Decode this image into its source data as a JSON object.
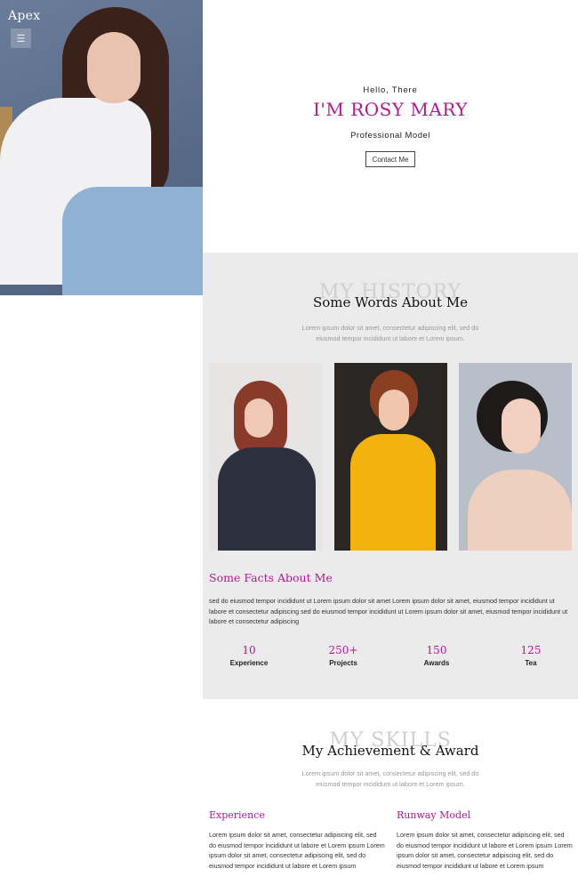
{
  "brand": "Apex",
  "menu_icon": "☰",
  "hero": {
    "greeting": "Hello, There",
    "name": "I'M ROSY MARY",
    "role": "Professional Model",
    "contact_label": "Contact Me"
  },
  "history": {
    "ghost_title": "MY HISTORY",
    "title": "Some Words About Me",
    "subtitle_line1": "Lorem ipsum dolor sit amet, consectetur adipiscing elit, sed do",
    "subtitle_line2": "eiusmod tempor incididunt ut labore et Lorem ipsum.",
    "facts_title": "Some Facts About Me",
    "facts_text": "sed do eiusmod tempor incididunt ut Lorem ipsum dolor sit amet Lorem ipsum dolor sit amet, eiusmod tempor incididunt ut labore et consectetur adipiscing sed do eiusmod tempor incididunt ut Lorem ipsum dolor sit amet, eiusmod tempor incididunt ut labore et consectetur adipiscing",
    "stats": [
      {
        "value": "10",
        "label": "Experience"
      },
      {
        "value": "250+",
        "label": "Projects"
      },
      {
        "value": "150",
        "label": "Awards"
      },
      {
        "value": "125",
        "label": "Tea"
      }
    ]
  },
  "skills": {
    "ghost_title": "MY SKILLS",
    "title": "My Achievement & Award",
    "subtitle_line1": "Lorem ipsum dolor sit amet, consectetur adipiscing elit, sed do",
    "subtitle_line2": "eiusmod tempor incididunt ut labore et Lorem ipsum.",
    "columns": [
      {
        "title": "Experience",
        "text": "Lorem ipsum dolor sit amet, consectetur adipiscing elit, sed do eiusmod tempor incididunt ut labore et Lorem ipsum Lorem ipsum dolor sit amet, consectetur adipiscing elit, sed do eiusmod tempor incididunt ut labore et Lorem ipsum"
      },
      {
        "title": "Runway Model",
        "text": "Lorem ipsum dolor sit amet, consectetur adipiscing elit, sed do eiusmod tempor incididunt ut labore et Lorem ipsum Lorem ipsum dolor sit amet, consectetur adipiscing elit, sed do eiusmod tempor incididunt ut labore et Lorem ipsum"
      }
    ]
  },
  "colors": {
    "accent": "#b0198f",
    "section_bg": "#ebebeb"
  }
}
